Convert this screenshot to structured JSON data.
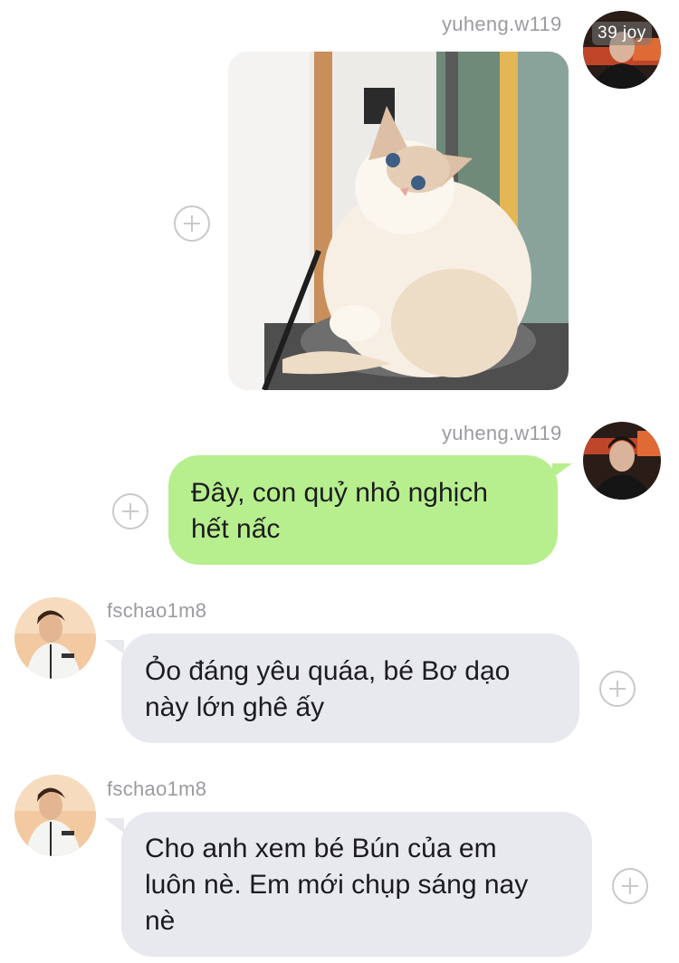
{
  "messages": [
    {
      "sender": "yuheng.w119",
      "type": "image",
      "image_desc": "cat-photo"
    },
    {
      "sender": "yuheng.w119",
      "type": "text",
      "line1": "Đây, con quỷ nhỏ nghịch",
      "line2": "hết nấc"
    },
    {
      "sender": "fschao1m8",
      "type": "text",
      "line1": "Ỏo đáng yêu quáa, bé Bơ dạo",
      "line2": "này lớn ghê ấy"
    },
    {
      "sender": "fschao1m8",
      "type": "text",
      "line1": "Cho anh xem bé Bún của em",
      "line2": "luôn nè. Em mới chụp sáng nay",
      "line3": "nè"
    }
  ],
  "avatar_badge": "39 joy",
  "colors": {
    "outgoing_bubble": "#b7ef8f",
    "incoming_bubble": "#e8e9ee",
    "username": "#9b9ba0",
    "plus_icon": "#c9c9cc"
  }
}
